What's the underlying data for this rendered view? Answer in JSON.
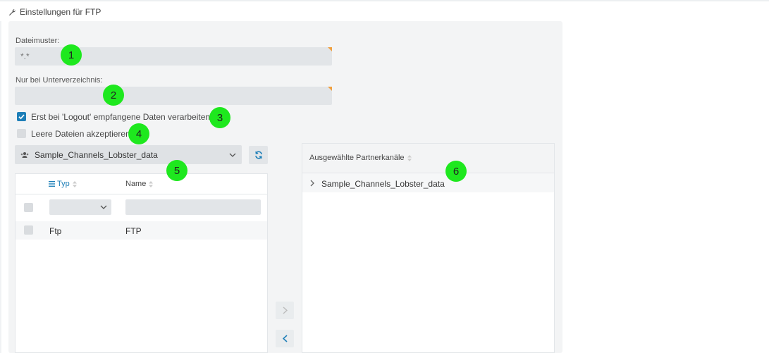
{
  "header": {
    "title": "Einstellungen für FTP"
  },
  "form": {
    "file_pattern": {
      "label": "Dateimuster:",
      "value": "*.*"
    },
    "subdir": {
      "label": "Nur bei Unterverzeichnis:",
      "value": ""
    },
    "logout_checkbox": {
      "label": "Erst bei 'Logout' empfangene Daten verarbeiten",
      "checked": true
    },
    "empty_files_checkbox": {
      "label": "Leere Dateien akzeptieren",
      "checked": false
    }
  },
  "partner_select": {
    "value": "Sample_Channels_Lobster_data"
  },
  "table": {
    "columns": {
      "type": "Typ",
      "name": "Name"
    },
    "rows": [
      {
        "type": "Ftp",
        "name": "FTP"
      }
    ]
  },
  "selected_channels": {
    "header": "Ausgewählte Partnerkanäle",
    "items": [
      "Sample_Channels_Lobster_data"
    ]
  },
  "markers": [
    "1",
    "2",
    "3",
    "4",
    "5",
    "6"
  ],
  "colors": {
    "accent": "#1e7fb8",
    "marker": "#1ee81e",
    "required_corner": "#f0a040"
  }
}
